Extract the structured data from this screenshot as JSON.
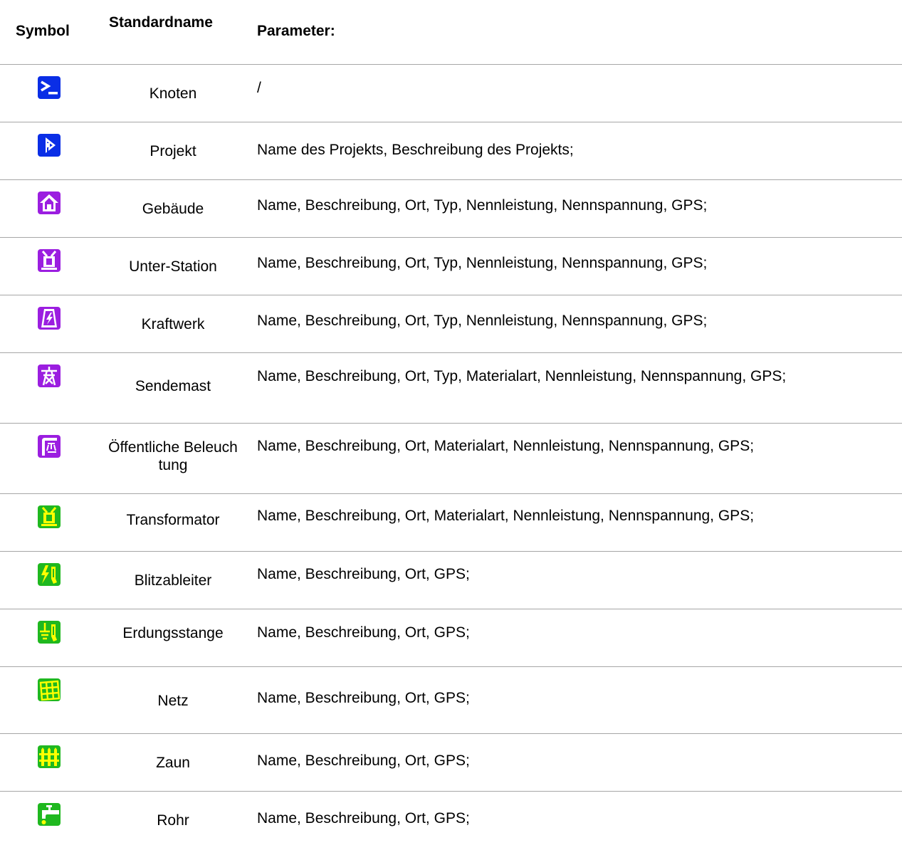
{
  "header": {
    "symbol": "Symbol",
    "name": "Standardname",
    "params": "Parameter:"
  },
  "colors": {
    "blue": "#0a2ee6",
    "purple": "#9b1ee0",
    "green": "#1fb81f",
    "divider": "#a6a6a6"
  },
  "rows": [
    {
      "name": "Knoten",
      "params": "/",
      "icon": "terminal-icon"
    },
    {
      "name": "Projekt",
      "params": "Name des Projekts, Beschreibung des Projekts;",
      "icon": "project-icon"
    },
    {
      "name": "Gebäude",
      "params": "Name, Beschreibung, Ort, Typ, Nennleistung, Nennspannung, GPS;",
      "icon": "building-icon"
    },
    {
      "name": "Unter-Station",
      "params": "Name, Beschreibung, Ort, Typ, Nennleistung, Nennspannung, GPS;",
      "icon": "substation-icon"
    },
    {
      "name": "Kraftwerk",
      "params": "Name, Beschreibung, Ort, Typ, Nennleistung, Nennspannung, GPS;",
      "icon": "power-plant-icon"
    },
    {
      "name": "Sendemast",
      "params": "Name, Beschreibung, Ort, Typ, Materialart, Nennleistung, Nennspannung, GPS;",
      "icon": "transmission-tower-icon"
    },
    {
      "name": "Öffentliche Beleuchtung",
      "params": "Name, Beschreibung, Ort, Materialart, Nennleistung, Nennspannung, GPS;",
      "icon": "street-light-icon"
    },
    {
      "name": "Transformator",
      "params": "Name, Beschreibung, Ort, Materialart, Nennleistung, Nennspannung, GPS;",
      "icon": "transformer-icon"
    },
    {
      "name": "Blitzableiter",
      "params": "Name, Beschreibung, Ort, GPS;",
      "icon": "lightning-rod-icon"
    },
    {
      "name": "Erdungsstange",
      "params": "Name, Beschreibung, Ort, GPS;",
      "icon": "earthing-rod-icon"
    },
    {
      "name": "Netz",
      "params": "Name, Beschreibung, Ort, GPS;",
      "icon": "grid-icon"
    },
    {
      "name": "Zaun",
      "params": "Name, Beschreibung, Ort, GPS;",
      "icon": "fence-icon"
    },
    {
      "name": "Rohr",
      "params": "Name, Beschreibung, Ort, GPS;",
      "icon": "pipe-icon"
    }
  ]
}
